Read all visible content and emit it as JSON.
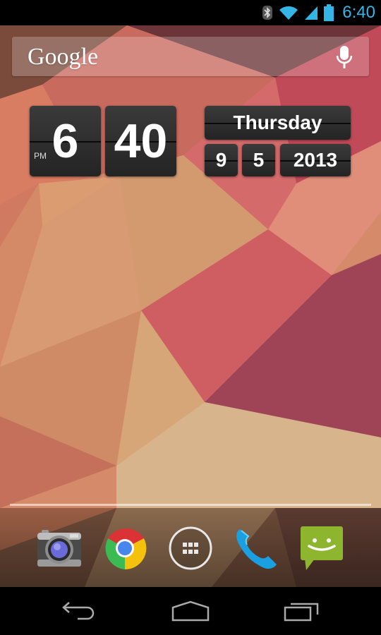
{
  "status_bar": {
    "time": "6:40",
    "icons": [
      "bluetooth-icon",
      "wifi-icon",
      "cell-signal-icon",
      "battery-icon"
    ],
    "accent_color": "#33b5e5"
  },
  "search_widget": {
    "logo_text": "Google",
    "voice_icon": "mic-icon"
  },
  "clock_widget": {
    "hour": "6",
    "minute": "40",
    "ampm": "PM",
    "weekday": "Thursday",
    "month": "9",
    "day": "5",
    "year": "2013"
  },
  "dock": {
    "apps": [
      {
        "name": "Camera",
        "icon": "camera-icon"
      },
      {
        "name": "Chrome",
        "icon": "chrome-icon"
      },
      {
        "name": "All Apps",
        "icon": "app-drawer-icon"
      },
      {
        "name": "Phone",
        "icon": "phone-icon"
      },
      {
        "name": "Messaging",
        "icon": "messaging-icon"
      }
    ]
  },
  "nav_bar": {
    "buttons": [
      {
        "name": "Back",
        "icon": "back-icon"
      },
      {
        "name": "Home",
        "icon": "home-icon"
      },
      {
        "name": "Recent Apps",
        "icon": "recents-icon"
      }
    ]
  }
}
